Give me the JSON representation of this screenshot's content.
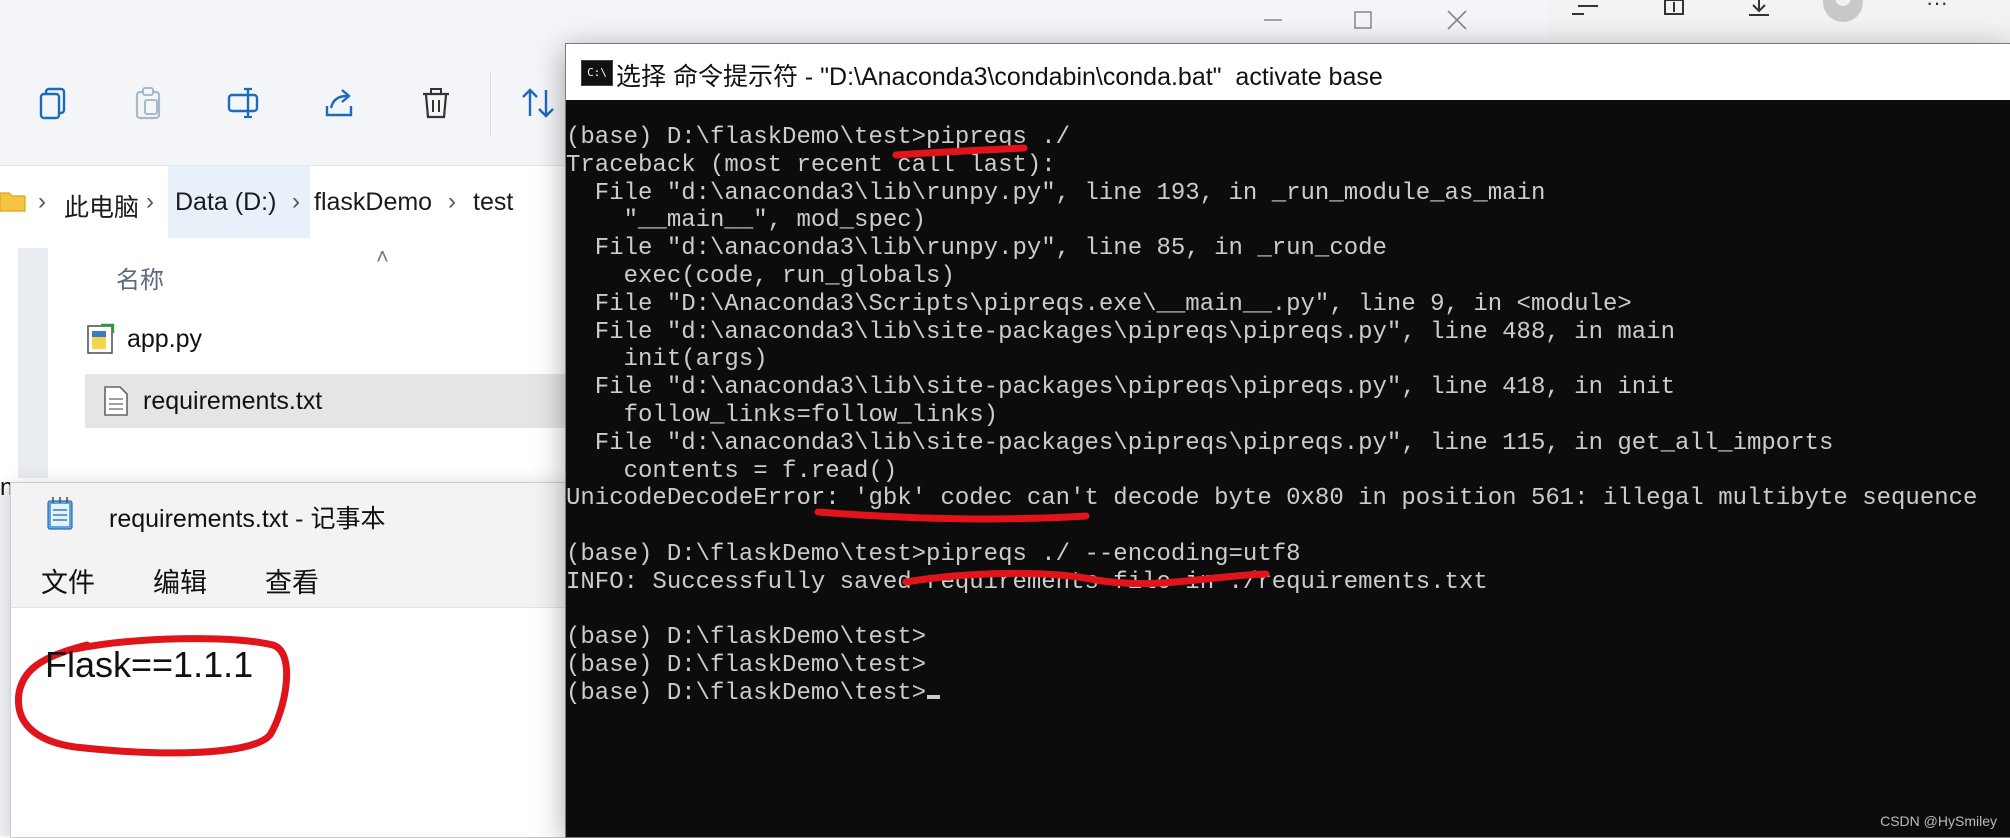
{
  "explorer": {
    "toolbar": {
      "copy_icon": "copy-icon",
      "paste_icon": "paste-icon",
      "rename_icon": "rename-icon",
      "share_icon": "share-icon",
      "delete_icon": "trash-icon",
      "sort_icon": "sort-icon"
    },
    "breadcrumb": [
      "此电脑",
      "Data (D:)",
      "flaskDemo",
      "test"
    ],
    "column_header": "名称",
    "files": [
      {
        "name": "app.py",
        "icon": "python-file-icon",
        "selected": false
      },
      {
        "name": "requirements.txt",
        "icon": "text-file-icon",
        "selected": true
      }
    ],
    "partial_letter": "n"
  },
  "notepad": {
    "title": "requirements.txt - 记事本",
    "menu": [
      "文件",
      "编辑",
      "查看"
    ],
    "content": "Flask==1.1.1"
  },
  "cmd": {
    "title": "选择 命令提示符 - \"D:\\Anaconda3\\condabin\\conda.bat\"  activate base",
    "lines": [
      "(base) D:\\flaskDemo\\test>pipreqs ./",
      "Traceback (most recent call last):",
      "  File \"d:\\anaconda3\\lib\\runpy.py\", line 193, in _run_module_as_main",
      "    \"__main__\", mod_spec)",
      "  File \"d:\\anaconda3\\lib\\runpy.py\", line 85, in _run_code",
      "    exec(code, run_globals)",
      "  File \"D:\\Anaconda3\\Scripts\\pipreqs.exe\\__main__.py\", line 9, in <module>",
      "  File \"d:\\anaconda3\\lib\\site-packages\\pipreqs\\pipreqs.py\", line 488, in main",
      "    init(args)",
      "  File \"d:\\anaconda3\\lib\\site-packages\\pipreqs\\pipreqs.py\", line 418, in init",
      "    follow_links=follow_links)",
      "  File \"d:\\anaconda3\\lib\\site-packages\\pipreqs\\pipreqs.py\", line 115, in get_all_imports",
      "    contents = f.read()",
      "UnicodeDecodeError: 'gbk' codec can't decode byte 0x80 in position 561: illegal multibyte sequence",
      "",
      "(base) D:\\flaskDemo\\test>pipreqs ./ --encoding=utf8",
      "INFO: Successfully saved requirements file in ./requirements.txt",
      "",
      "(base) D:\\flaskDemo\\test>",
      "(base) D:\\flaskDemo\\test>",
      "(base) D:\\flaskDemo\\test>"
    ]
  },
  "colors": {
    "annotation_red": "#e0141b",
    "cmd_background": "#0c0c0c",
    "cmd_text": "#cccccc"
  },
  "watermark": "CSDN @HySmiley"
}
